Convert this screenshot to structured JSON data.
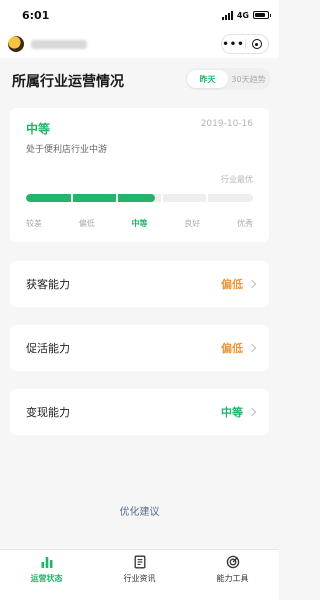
{
  "status_bar": {
    "time": "6:01",
    "network": "4G",
    "battery_level": 0.85
  },
  "page": {
    "title": "所属行业运营情况"
  },
  "range_toggle": {
    "options": [
      {
        "label": "昨天",
        "active": true
      },
      {
        "label": "30天趋势",
        "active": false
      }
    ]
  },
  "industry_level": {
    "level": "中等",
    "date": "2019-10-16",
    "description": "处于便利店行业中游",
    "bar_caption": "行业最优",
    "progress": 0.57,
    "scale": [
      "较差",
      "偏低",
      "中等",
      "良好",
      "优秀"
    ],
    "current_index": 2
  },
  "abilities": [
    {
      "name": "获客能力",
      "value": "偏低",
      "color": "#e8983a"
    },
    {
      "name": "促活能力",
      "value": "偏低",
      "color": "#e8983a"
    },
    {
      "name": "变现能力",
      "value": "中等",
      "color": "#20b469"
    }
  ],
  "suggest_label": "优化建议",
  "tabs": [
    {
      "label": "运营状态",
      "icon": "bar-chart-icon",
      "active": true
    },
    {
      "label": "行业资讯",
      "icon": "document-icon",
      "active": false
    },
    {
      "label": "能力工具",
      "icon": "target-icon",
      "active": false
    }
  ],
  "colors": {
    "accent": "#20b469",
    "warning": "#e8983a",
    "inactive": "#333333",
    "link": "#566b8a"
  }
}
